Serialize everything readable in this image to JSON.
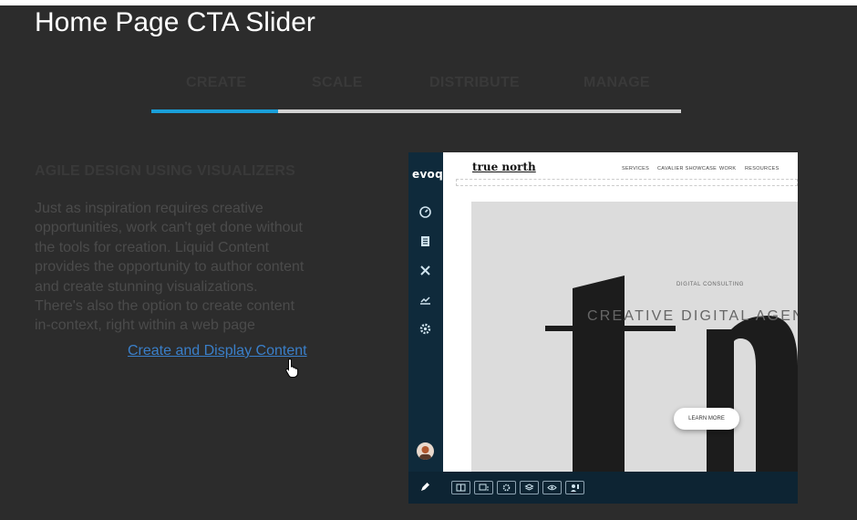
{
  "page": {
    "title": "Home Page CTA Slider"
  },
  "tabs": [
    {
      "label": "CREATE"
    },
    {
      "label": "SCALE"
    },
    {
      "label": "DISTRIBUTE"
    },
    {
      "label": "MANAGE"
    }
  ],
  "progress": {
    "fraction": 0.24,
    "color": "#1a9fd9"
  },
  "content": {
    "heading": "AGILE DESIGN USING VISUALIZERS",
    "body": "Just as inspiration requires creative opportunities, work can't get done without the tools for creation. Liquid Content provides the opportunity to author content and create stunning visualizations. There's also the option to create content in-context, right within a web page",
    "link": "Create and Display Content"
  },
  "preview": {
    "brand": "evoq",
    "rail_icons": [
      "dashboard-icon",
      "content-icon",
      "tools-icon",
      "analytics-icon",
      "settings-icon"
    ],
    "site": {
      "brand": "true north",
      "nav": [
        "SERVICES",
        "CAVALIER SHOWCASE",
        "WORK",
        "RESOURCES"
      ],
      "eyebrow": "DIGITAL CONSULTING",
      "headline": "CREATIVE DIGITAL AGEN",
      "button": "LEARN MORE"
    },
    "toolbar_icons": [
      "page-icon",
      "pages-icon",
      "gear-icon",
      "layers-icon",
      "eye-icon",
      "user-icon"
    ]
  }
}
